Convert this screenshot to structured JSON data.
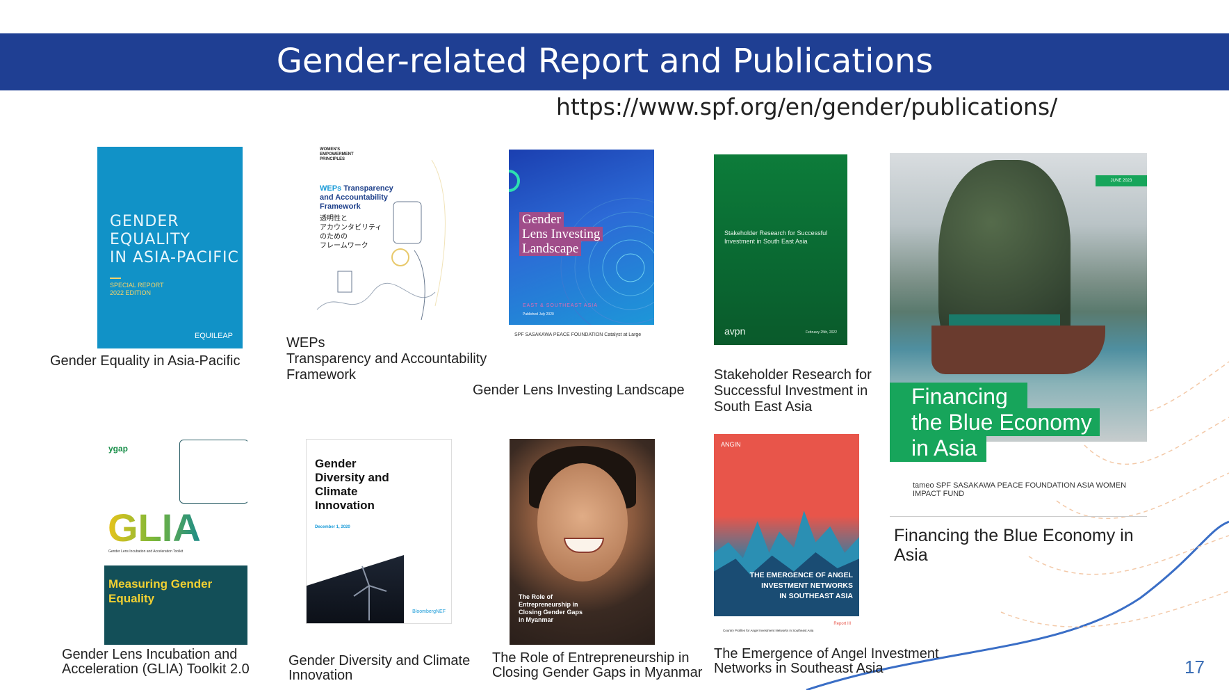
{
  "slide": {
    "title": "Gender-related Report and Publications",
    "url": "https://www.spf.org/en/gender/publications/",
    "page_number": "17"
  },
  "publications": [
    {
      "caption": "Gender Equality in Asia-Pacific",
      "cover_title": "GENDER\nEQUALITY\nIN ASIA-PACIFIC",
      "cover_subtitle": "SPECIAL REPORT\n2022 EDITION",
      "cover_logo": "EQUILEAP",
      "color": "#1192c7"
    },
    {
      "caption": "WEPs\nTransparency and Accountability\nFramework",
      "cover_header": "WOMEN'S\nEMPOWERMENT\nPRINCIPLES",
      "cover_title_accent": "WEPs",
      "cover_title": " Transparency\nand Accountability\nFramework",
      "cover_title_jp": "透明性と\nアカウンタビリティ\nのための\nフレームワーク"
    },
    {
      "caption": "Gender Lens Investing Landscape",
      "cover_title": [
        "Gender",
        "Lens Investing",
        "Landscape"
      ],
      "cover_subtitle": "EAST & SOUTHEAST ASIA",
      "cover_date": "Published July 2020",
      "cover_logos": "SPF  SASAKAWA PEACE FOUNDATION     Catalyst at Large"
    },
    {
      "caption": "Stakeholder Research for\nSuccessful Investment in\nSouth East Asia",
      "cover_title": "Stakeholder Research for Successful\nInvestment in South East Asia",
      "cover_logo": "avpn",
      "cover_date": "February 25th, 2022"
    },
    {
      "caption": "Financing the Blue Economy in\nAsia",
      "cover_badge": "JUNE 2023",
      "cover_title": [
        "Financing",
        "the Blue Economy",
        "in Asia"
      ],
      "cover_logos": "tameo     SPF SASAKAWA PEACE FOUNDATION     ASIA WOMEN IMPACT FUND"
    },
    {
      "caption": "Gender Lens Incubation and\nAcceleration (GLIA) Toolkit 2.0",
      "cover_brand": "ygap",
      "cover_title": "GLIA",
      "cover_subtitle": "Gender Lens Incubation and Acceleration Toolkit",
      "cover_box": "Measuring Gender\nEquality"
    },
    {
      "caption": "Gender Diversity and Climate\nInnovation",
      "cover_title": "Gender\nDiversity and\nClimate\nInnovation",
      "cover_date": "December 1, 2020",
      "cover_logo": "BloombergNEF"
    },
    {
      "caption": "The Role of Entrepreneurship in\nClosing Gender Gaps in Myanmar",
      "cover_title": "The Role of\nEntrepreneurship in\nClosing Gender Gaps\nin Myanmar"
    },
    {
      "caption": "The Emergence of Angel Investment\nNetworks in Southeast Asia",
      "cover_header": "ANGIN",
      "cover_title": "THE EMERGENCE OF ANGEL\nINVESTMENT NETWORKS\nIN SOUTHEAST ASIA",
      "cover_report": "Report III",
      "cover_footer": "Country Profiles for Angel Investment Networks in Southeast Asia"
    }
  ],
  "colors": {
    "banner": "#1f3f93",
    "accent_line": "#3b6eb5"
  }
}
